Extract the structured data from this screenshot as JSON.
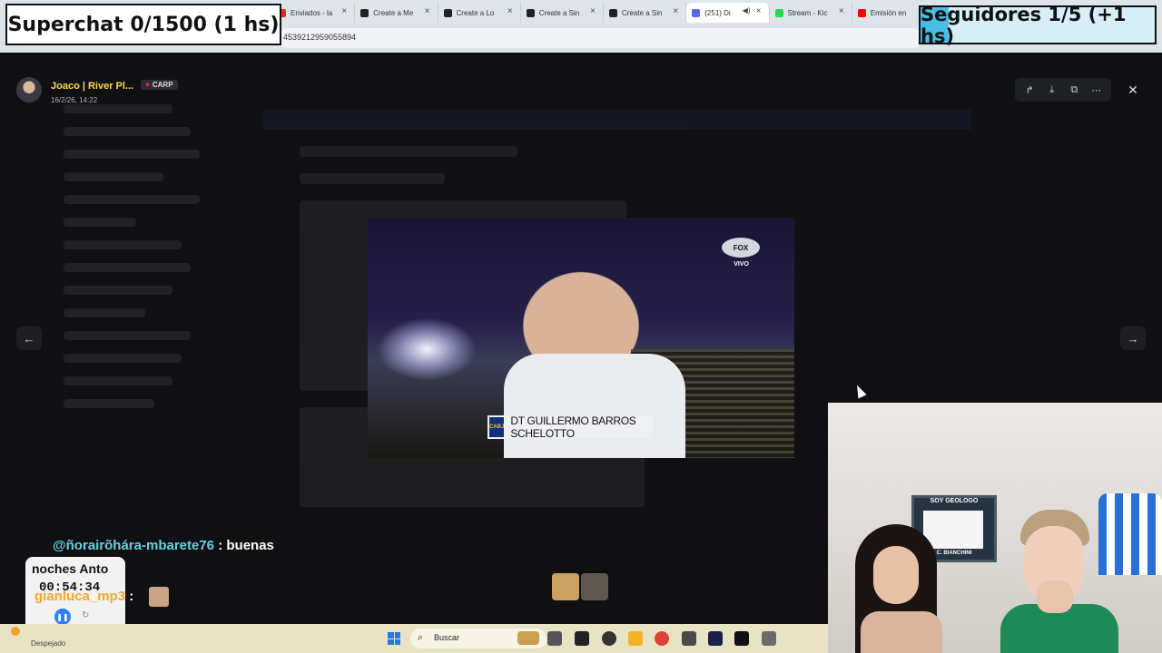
{
  "overlays": {
    "superchat": "Superchat 0/1500 (1 hs)",
    "seguidores": "Seguidores 1/5 (+1 hs)"
  },
  "browser": {
    "tabs": [
      {
        "label": "Enviados - la",
        "color": "#d93025"
      },
      {
        "label": "Create a Me",
        "color": "#222222"
      },
      {
        "label": "Create a Lo",
        "color": "#222222"
      },
      {
        "label": "Create a Sin",
        "color": "#222222"
      },
      {
        "label": "Create a Sin",
        "color": "#222222"
      },
      {
        "label": "(251) Di",
        "color": "#5865f2"
      },
      {
        "label": "Stream - Kic",
        "color": "#2bd957"
      },
      {
        "label": "Emisión en",
        "color": "#ff0000"
      }
    ],
    "address": "4539212959055894"
  },
  "viewer": {
    "uploader_name": "Joaco | River Pl...",
    "tag": "CARP",
    "date": "16/2/26, 14:22",
    "tools": [
      "share-icon",
      "download-icon",
      "open-external-icon",
      "more-icon"
    ],
    "close": "✕",
    "prev": "←",
    "next": "→"
  },
  "media": {
    "channel": "FOX",
    "channel_sub": "VIVO",
    "crest": "CABJ",
    "lower_third": "DT GUILLERMO BARROS SCHELOTTO"
  },
  "stream_chat": {
    "messages": [
      {
        "user": "@ñorairõhára-mbarete76",
        "sep": " : ",
        "text": "buenas"
      },
      {
        "user": "gianluca_mp3",
        "sep": " : "
      }
    ],
    "continuation": "noches Anto",
    "timer": "00:54:34"
  },
  "webcam": {
    "frame_top": "SOY GEOLOGO",
    "frame_bottom": "C. BIANCHINI"
  },
  "taskbar": {
    "weather": "Despejado",
    "search_placeholder": "Buscar",
    "pinned": [
      {
        "name": "files-icon",
        "color": "#555555"
      },
      {
        "name": "capcut-icon",
        "color": "#222222"
      },
      {
        "name": "obs-icon",
        "color": "#333333"
      },
      {
        "name": "folder-icon",
        "color": "#f0b429"
      },
      {
        "name": "chrome-icon",
        "color": "#db4437"
      },
      {
        "name": "app-icon",
        "color": "#4a4a4a"
      },
      {
        "name": "photoshop-icon",
        "color": "#1b1f4b"
      },
      {
        "name": "kick-icon",
        "color": "#111111"
      },
      {
        "name": "yandex-icon",
        "color": "#6b6b6b"
      }
    ]
  }
}
